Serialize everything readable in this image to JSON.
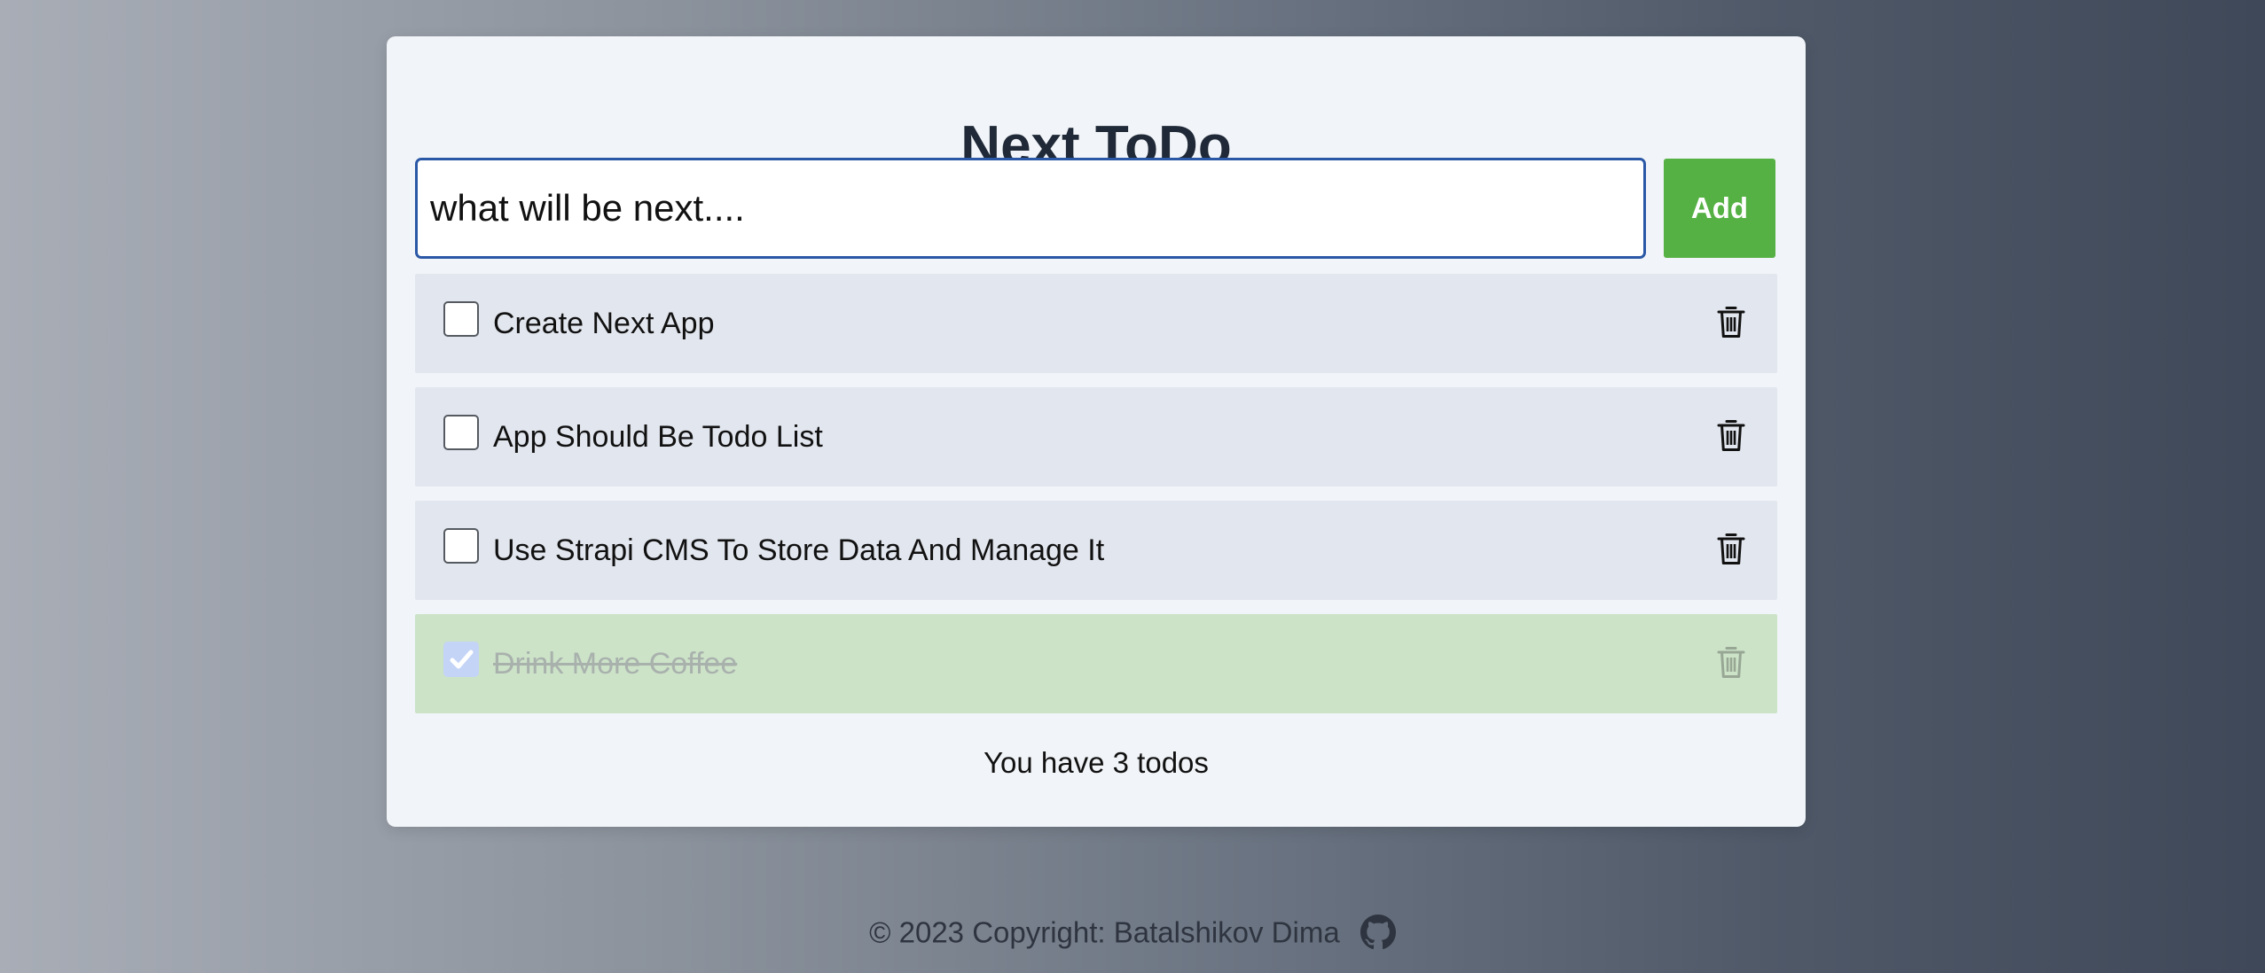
{
  "app": {
    "title": "Next ToDo"
  },
  "input": {
    "value": "",
    "placeholder": "what will be next...."
  },
  "add_button": {
    "label": "Add"
  },
  "todos": [
    {
      "text": "Create Next App",
      "completed": false
    },
    {
      "text": "App Should Be Todo List",
      "completed": false
    },
    {
      "text": "Use Strapi CMS To Store Data And Manage It",
      "completed": false
    },
    {
      "text": "Drink More Coffee",
      "completed": true
    }
  ],
  "summary": {
    "count_text": "You have 3 todos"
  },
  "footer": {
    "copyright": "© 2023 Copyright: Batalshikov Dima",
    "link_icon": "github-icon"
  },
  "colors": {
    "accent_green": "#56b144",
    "focus_blue": "#2b58a6",
    "card_bg": "#f1f4f8",
    "item_bg": "#e2e6ee",
    "done_bg": "#cce3c8",
    "title_text": "#1f2937"
  },
  "icons": {
    "delete": "trash-icon",
    "check": "check-icon"
  }
}
